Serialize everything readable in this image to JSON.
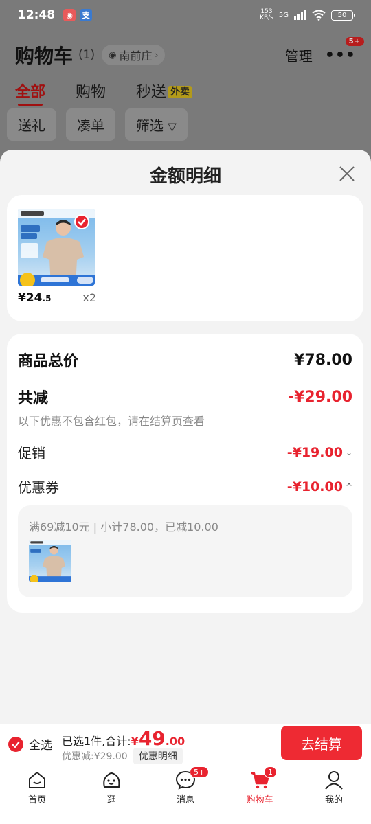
{
  "status_bar": {
    "time": "12:48",
    "speed_value": "153",
    "speed_unit": "KB/s",
    "network": "5G",
    "battery": "50"
  },
  "header": {
    "title": "购物车",
    "count": "(1)",
    "location": "南前庄",
    "manage": "管理",
    "more_badge": "5+"
  },
  "tabs": [
    {
      "label": "全部"
    },
    {
      "label": "购物"
    },
    {
      "label": "秒送"
    }
  ],
  "tab_tag": "外卖",
  "chips": [
    {
      "label": "送礼"
    },
    {
      "label": "凑单"
    },
    {
      "label": "筛选"
    }
  ],
  "sheet": {
    "title": "金额明细",
    "item": {
      "price_symbol": "¥",
      "price_int": "24",
      "price_dec": ".5",
      "qty": "x2"
    },
    "total_label": "商品总价",
    "total_value": "¥78.00",
    "reduce_label": "共减",
    "reduce_value": "-¥29.00",
    "note": "以下优惠不包含红包，请在结算页查看",
    "promo_label": "促销",
    "promo_value": "-¥19.00",
    "coupon_label": "优惠券",
    "coupon_value": "-¥10.00",
    "coupon_detail": "满69减10元 | 小计78.00，已减10.00"
  },
  "checkout": {
    "select_all": "全选",
    "selected_text": "已选1件,合计:",
    "total_yen": "¥",
    "total_int": "49",
    "total_dec": ".00",
    "discount_text": "优惠减:¥29.00",
    "detail_label": "优惠明细",
    "pay_label": "去结算"
  },
  "tabbar": [
    {
      "label": "首页",
      "icon": "home-icon"
    },
    {
      "label": "逛",
      "icon": "explore-icon"
    },
    {
      "label": "消息",
      "icon": "message-icon",
      "badge": "5+"
    },
    {
      "label": "购物车",
      "icon": "cart-icon",
      "badge": "1",
      "active": true
    },
    {
      "label": "我的",
      "icon": "profile-icon"
    }
  ],
  "colors": {
    "accent": "#e8232f",
    "overlay": "#7a7a7a"
  }
}
